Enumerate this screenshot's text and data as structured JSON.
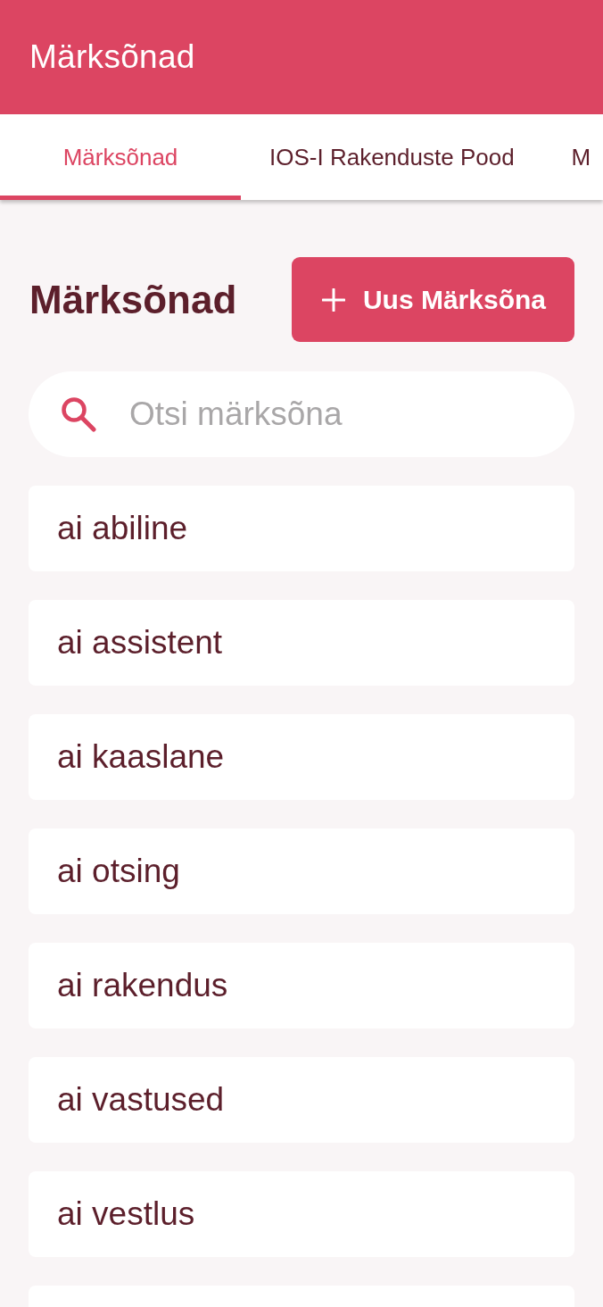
{
  "app_bar": {
    "title": "Märksõnad"
  },
  "tabs": [
    {
      "label": "Märksõnad",
      "selected": true
    },
    {
      "label": "IOS-I Rakenduste Pood",
      "selected": false
    },
    {
      "label": "M",
      "selected": false
    }
  ],
  "page": {
    "heading": "Märksõnad",
    "new_button": {
      "label": "Uus Märksõna"
    }
  },
  "search": {
    "placeholder": "Otsi märksõna"
  },
  "keywords": {
    "items": [
      {
        "label": "ai abiline"
      },
      {
        "label": "ai assistent"
      },
      {
        "label": "ai kaaslane"
      },
      {
        "label": "ai otsing"
      },
      {
        "label": "ai rakendus"
      },
      {
        "label": "ai vastused"
      },
      {
        "label": "ai vestlus"
      }
    ],
    "more_below": true
  }
}
